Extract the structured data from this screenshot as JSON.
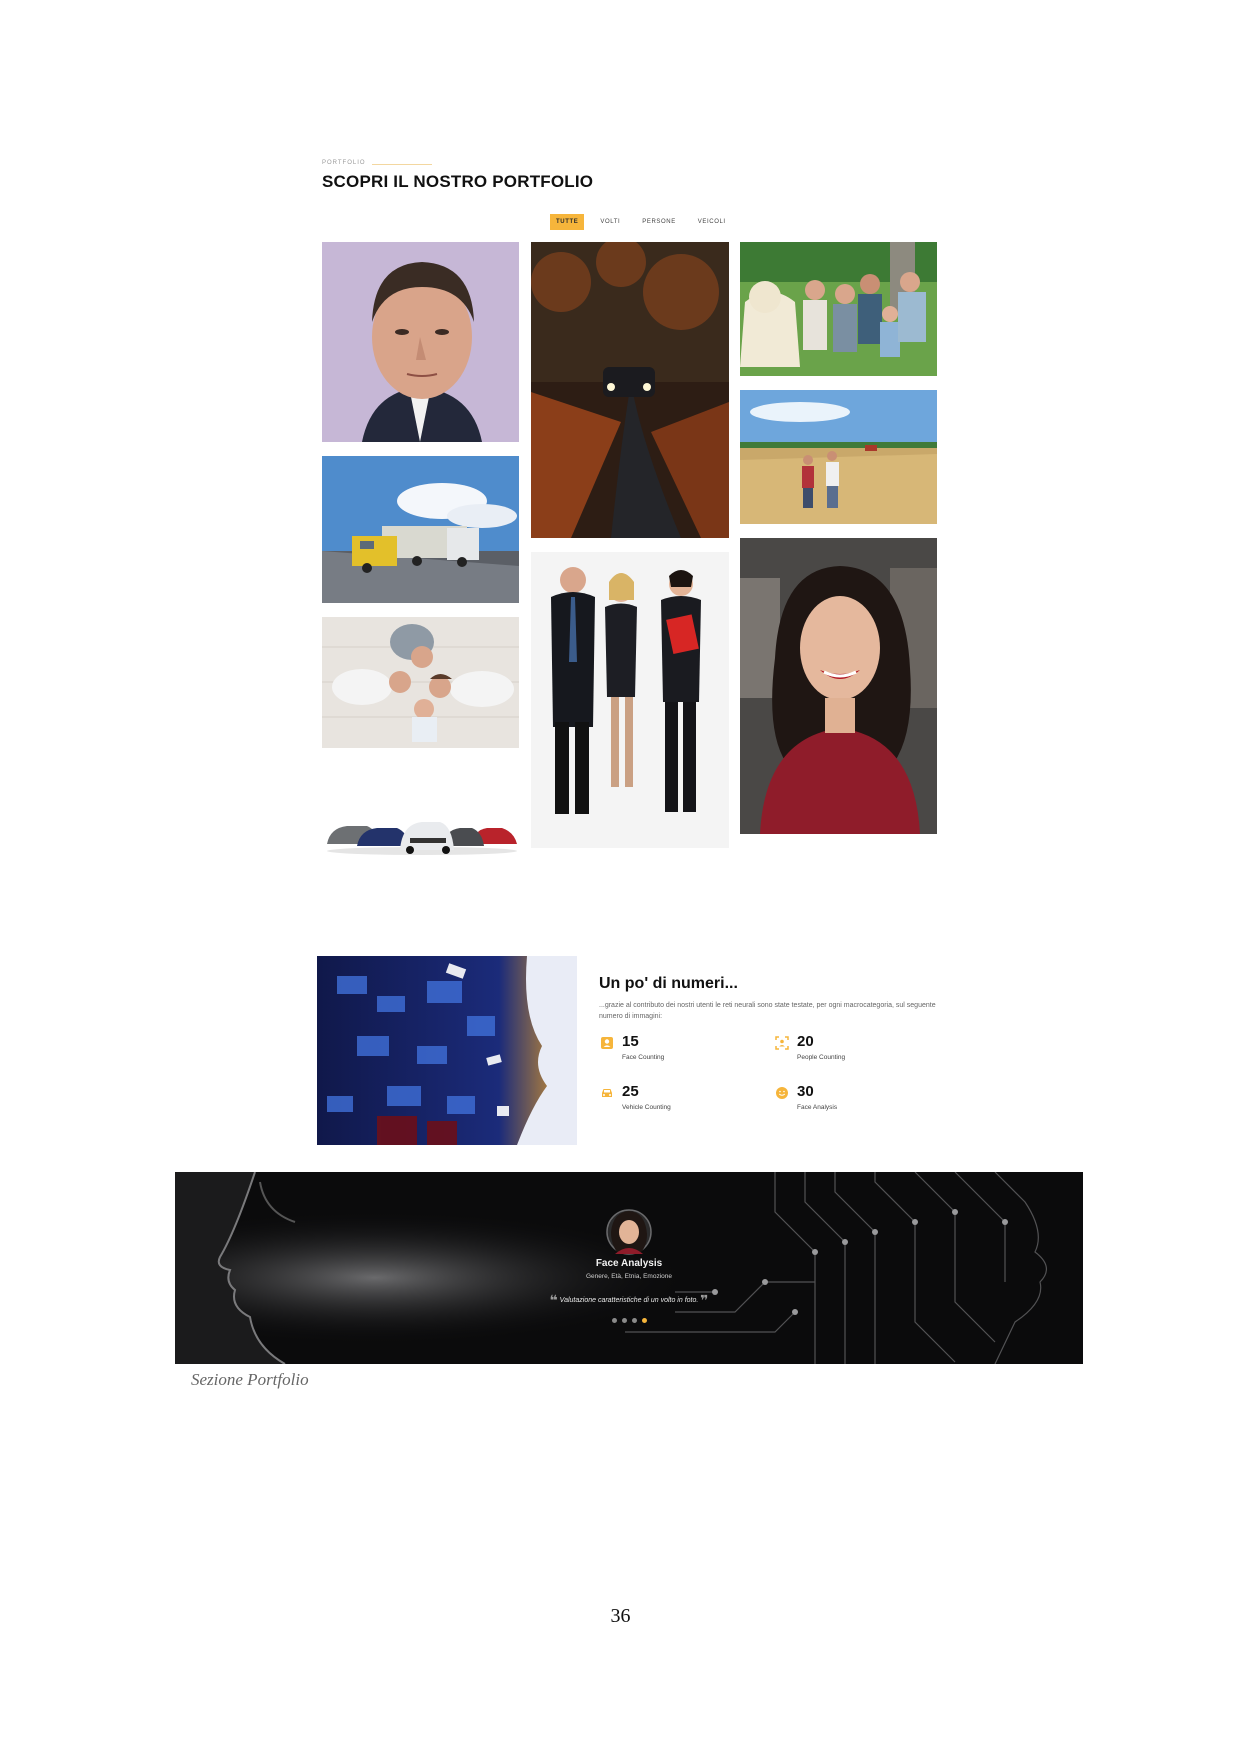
{
  "portfolio": {
    "eyebrow": "PORTFOLIO",
    "title": "SCOPRI IL NOSTRO PORTFOLIO",
    "filters": [
      {
        "label": "TUTTE",
        "active": true
      },
      {
        "label": "VOLTI",
        "active": false
      },
      {
        "label": "PERSONE",
        "active": false
      },
      {
        "label": "VEICOLI",
        "active": false
      }
    ]
  },
  "numbers": {
    "title": "Un po' di numeri...",
    "description": "...grazie al contributo dei nostri utenti le reti neurali sono state testate, per ogni macrocategoria, sul seguente numero di immagini:",
    "stats": [
      {
        "value": "15",
        "label": "Face Counting",
        "icon": "user-square-icon"
      },
      {
        "value": "20",
        "label": "People Counting",
        "icon": "scan-person-icon"
      },
      {
        "value": "25",
        "label": "Vehicle Counting",
        "icon": "car-icon"
      },
      {
        "value": "30",
        "label": "Face Analysis",
        "icon": "smile-icon"
      }
    ],
    "accent": "#f6b53b"
  },
  "testimonial": {
    "name": "Face Analysis",
    "subtitle": "Genere, Età, Etnia, Emozione",
    "quote": "Valutazione caratteristiche di un volto in foto."
  },
  "caption": "Sezione Portfolio",
  "page_number": "36"
}
